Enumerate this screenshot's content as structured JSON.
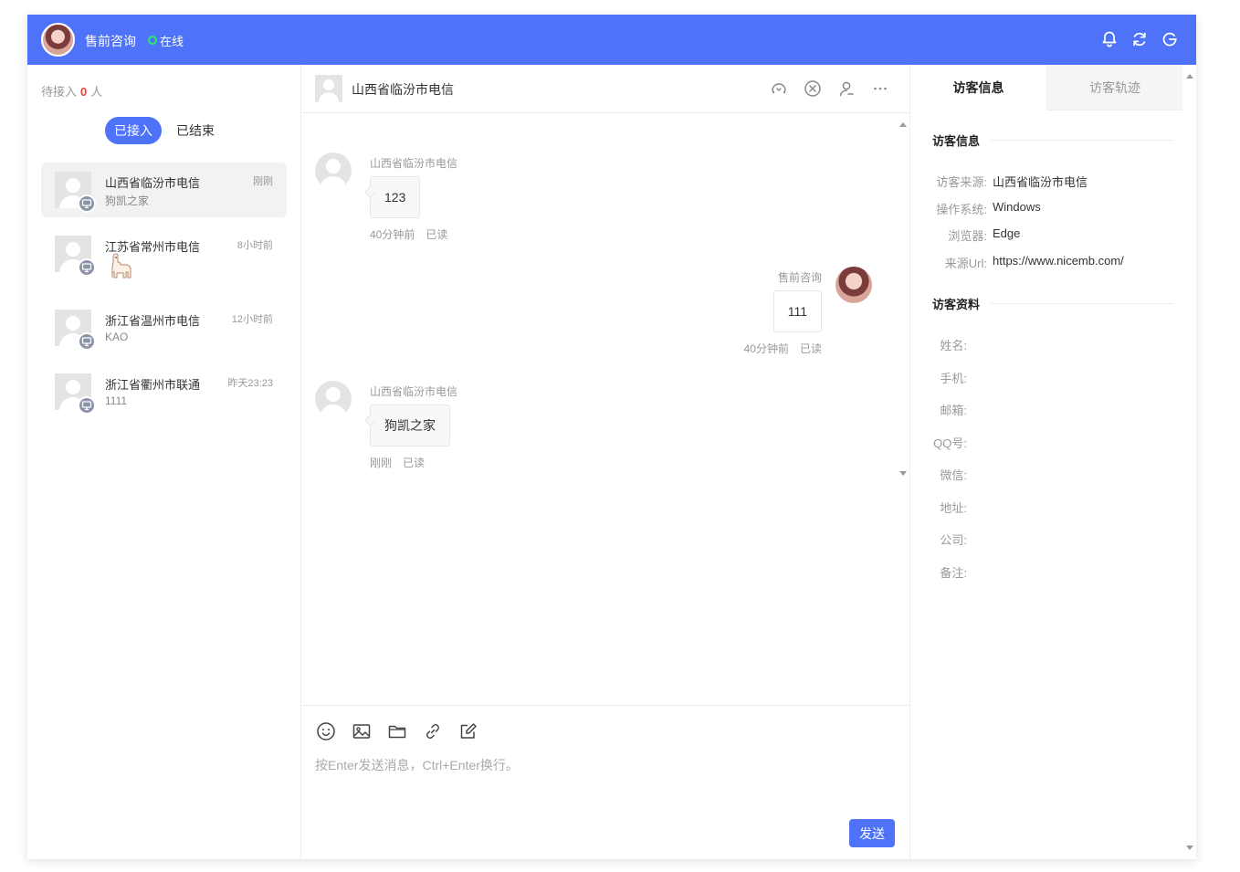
{
  "header": {
    "agent_name": "售前咨询",
    "status": "在线",
    "colors": {
      "brand": "#4e73f8",
      "online": "#2ee86b"
    },
    "icons": [
      "bell-icon",
      "refresh-icon",
      "logout-icon"
    ]
  },
  "sidebar": {
    "waiting_prefix": "待接入",
    "waiting_count": "0",
    "waiting_suffix": "人",
    "tabs": [
      {
        "label": "已接入",
        "active": true
      },
      {
        "label": "已结束",
        "active": false
      }
    ],
    "conversations": [
      {
        "name": "山西省临汾市电信",
        "time": "刚刚",
        "last_message": "狗凯之家",
        "selected": true
      },
      {
        "name": "江苏省常州市电信",
        "time": "8小时前",
        "last_message": "",
        "last_message_icon": "alpaca-sticker",
        "selected": false
      },
      {
        "name": "浙江省温州市电信",
        "time": "12小时前",
        "last_message": "KAO",
        "selected": false
      },
      {
        "name": "浙江省衢州市联通",
        "time": "昨天23:23",
        "last_message": "1111",
        "selected": false
      }
    ]
  },
  "chat": {
    "title": "山西省临汾市电信",
    "header_icons": [
      "transfer-icon",
      "close-circle-icon",
      "user-icon",
      "more-icon"
    ],
    "messages": [
      {
        "from": "visitor",
        "sender": "山西省临汾市电信",
        "text": "123",
        "time": "40分钟前",
        "status": "已读"
      },
      {
        "from": "agent",
        "sender": "售前咨询",
        "text": "111",
        "time": "40分钟前",
        "status": "已读"
      },
      {
        "from": "visitor",
        "sender": "山西省临汾市电信",
        "text": "狗凯之家",
        "time": "刚刚",
        "status": "已读"
      }
    ],
    "composer": {
      "tools": [
        "emoji-icon",
        "image-icon",
        "folder-icon",
        "link-icon",
        "edit-icon"
      ],
      "placeholder": "按Enter发送消息，Ctrl+Enter换行。",
      "send_label": "发送"
    }
  },
  "visitor_panel": {
    "tabs": [
      {
        "label": "访客信息",
        "active": true
      },
      {
        "label": "访客轨迹",
        "active": false
      }
    ],
    "info_title": "访客信息",
    "info": [
      {
        "label": "访客来源:",
        "value": "山西省临汾市电信"
      },
      {
        "label": "操作系统:",
        "value": "Windows"
      },
      {
        "label": "浏览器:",
        "value": "Edge"
      },
      {
        "label": "来源Url:",
        "value": "https://www.nicemb.com/"
      }
    ],
    "profile_title": "访客资料",
    "profile": [
      {
        "label": "姓名:",
        "value": ""
      },
      {
        "label": "手机:",
        "value": ""
      },
      {
        "label": "邮箱:",
        "value": ""
      },
      {
        "label": "QQ号:",
        "value": ""
      },
      {
        "label": "微信:",
        "value": ""
      },
      {
        "label": "地址:",
        "value": ""
      },
      {
        "label": "公司:",
        "value": ""
      },
      {
        "label": "备注:",
        "value": ""
      }
    ]
  }
}
